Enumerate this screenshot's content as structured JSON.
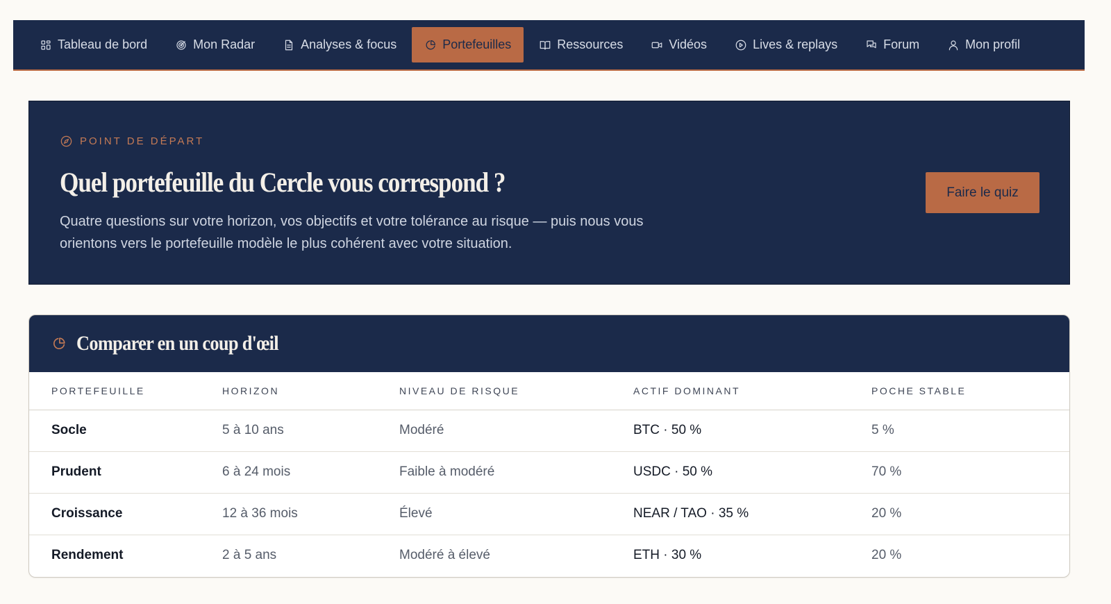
{
  "nav": {
    "items": [
      {
        "label": "Tableau de bord",
        "icon": "grid-icon",
        "active": false
      },
      {
        "label": "Mon Radar",
        "icon": "radar-icon",
        "active": false
      },
      {
        "label": "Analyses & focus",
        "icon": "document-icon",
        "active": false
      },
      {
        "label": "Portefeuilles",
        "icon": "pie-chart-icon",
        "active": true
      },
      {
        "label": "Ressources",
        "icon": "book-icon",
        "active": false
      },
      {
        "label": "Vidéos",
        "icon": "video-icon",
        "active": false
      },
      {
        "label": "Lives & replays",
        "icon": "play-circle-icon",
        "active": false
      },
      {
        "label": "Forum",
        "icon": "chat-icon",
        "active": false
      },
      {
        "label": "Mon profil",
        "icon": "user-icon",
        "active": false
      }
    ]
  },
  "hero": {
    "eyebrow": "POINT DE DÉPART",
    "eyebrow_icon": "compass-icon",
    "title": "Quel portefeuille du Cercle vous correspond ?",
    "text": "Quatre questions sur votre horizon, vos objectifs et votre tolérance au risque — puis nous vous orientons vers le portefeuille modèle le plus cohérent avec votre situation.",
    "button_label": "Faire le quiz"
  },
  "compare": {
    "title": "Comparer en un coup d'œil",
    "icon": "pie-chart-icon",
    "columns": [
      "PORTEFEUILLE",
      "HORIZON",
      "NIVEAU DE RISQUE",
      "ACTIF DOMINANT",
      "POCHE STABLE"
    ],
    "rows": [
      [
        "Socle",
        "5 à 10 ans",
        "Modéré",
        "BTC · 50 %",
        "5 %"
      ],
      [
        "Prudent",
        "6 à 24 mois",
        "Faible à modéré",
        "USDC · 50 %",
        "70 %"
      ],
      [
        "Croissance",
        "12 à 36 mois",
        "Élevé",
        "NEAR / TAO · 35 %",
        "20 %"
      ],
      [
        "Rendement",
        "2 à 5 ans",
        "Modéré à élevé",
        "ETH · 30 %",
        "20 %"
      ]
    ]
  },
  "colors": {
    "navy": "#1b2a4a",
    "accent": "#b96a45",
    "background": "#fcfaf6"
  }
}
